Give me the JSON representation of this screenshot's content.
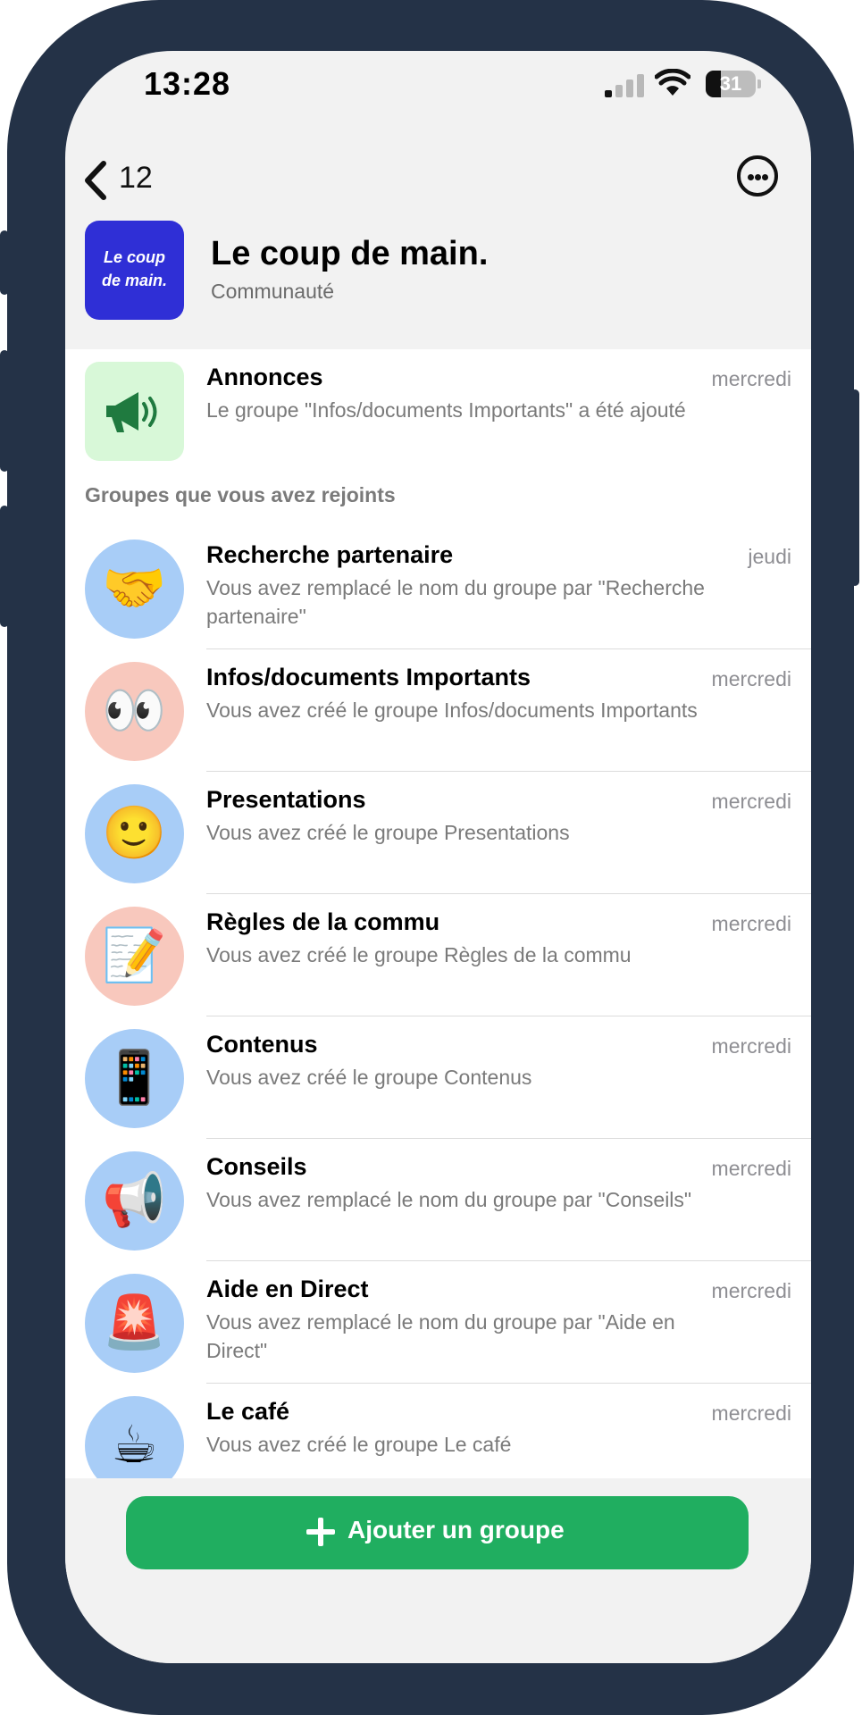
{
  "status_bar": {
    "time": "13:28",
    "battery": "31"
  },
  "nav": {
    "back_count": "12"
  },
  "community": {
    "logo_text_line1": "Le coup",
    "logo_text_line2": "de main.",
    "title": "Le coup de main.",
    "subtitle": "Communauté"
  },
  "announcements": {
    "title": "Annonces",
    "date": "mercredi",
    "preview": "Le groupe \"Infos/documents Importants\" a été ajouté",
    "icon": "megaphone-icon",
    "icon_bg": "#d8f8d8"
  },
  "section_label": "Groupes que vous avez rejoints",
  "groups": [
    {
      "title": "Recherche partenaire",
      "date": "jeudi",
      "preview": "Vous avez remplacé le nom du groupe par \"Recherche partenaire\"",
      "emoji": "🤝",
      "bg": "#a8cdf7"
    },
    {
      "title": "Infos/documents Importants",
      "date": "mercredi",
      "preview": "Vous avez créé le groupe Infos/documents Importants",
      "emoji": "👀",
      "bg": "#f8c8bd"
    },
    {
      "title": "Presentations",
      "date": "mercredi",
      "preview": "Vous avez créé le groupe Presentations",
      "emoji": "🙂",
      "bg": "#a8cdf7"
    },
    {
      "title": "Règles de la commu",
      "date": "mercredi",
      "preview": "Vous avez créé le groupe Règles de la commu",
      "emoji": "📝",
      "bg": "#f8c8bd"
    },
    {
      "title": "Contenus",
      "date": "mercredi",
      "preview": "Vous avez créé le groupe Contenus",
      "emoji": "📱",
      "bg": "#a8cdf7"
    },
    {
      "title": "Conseils",
      "date": "mercredi",
      "preview": "Vous avez remplacé le nom du groupe par \"Conseils\"",
      "emoji": "📢",
      "bg": "#a8cdf7"
    },
    {
      "title": "Aide en Direct",
      "date": "mercredi",
      "preview": "Vous avez remplacé le nom du groupe par \"Aide en Direct\"",
      "emoji": "🚨",
      "bg": "#a8cdf7"
    },
    {
      "title": "Le café",
      "date": "mercredi",
      "preview": "Vous avez créé le groupe Le café",
      "emoji": "☕",
      "bg": "#a8cdf7"
    }
  ],
  "footer": {
    "add_group_label": "Ajouter un groupe"
  }
}
